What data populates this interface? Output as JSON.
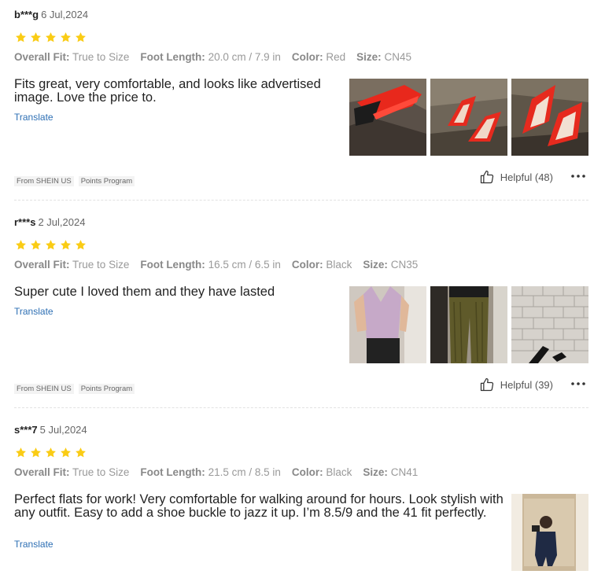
{
  "colors": {
    "star": "#facc15",
    "link": "#2d6fb4",
    "label": "#888888",
    "value": "#999999"
  },
  "icons": {
    "star": "star-icon",
    "helpful": "thumbs-up-icon",
    "more": "more-dots-icon"
  },
  "reviews": [
    {
      "user": "b***g",
      "date": "6 Jul,2024",
      "rating": 5,
      "attrs": [
        {
          "label": "Overall Fit:",
          "value": "True to Size"
        },
        {
          "label": "Foot Length:",
          "value": "20.0 cm / 7.9 in"
        },
        {
          "label": "Color:",
          "value": "Red"
        },
        {
          "label": "Size:",
          "value": "CN45"
        }
      ],
      "text": "Fits great, very comfortable, and looks like advertised image. Love the price to.",
      "translate": "Translate",
      "tags": [
        "From SHEIN US",
        "Points Program"
      ],
      "helpful": "Helpful (48)"
    },
    {
      "user": "r***s",
      "date": "2 Jul,2024",
      "rating": 5,
      "attrs": [
        {
          "label": "Overall Fit:",
          "value": "True to Size"
        },
        {
          "label": "Foot Length:",
          "value": "16.5 cm / 6.5 in"
        },
        {
          "label": "Color:",
          "value": "Black"
        },
        {
          "label": "Size:",
          "value": "CN35"
        }
      ],
      "text": "Super cute I loved them and they have lasted",
      "translate": "Translate",
      "tags": [
        "From SHEIN US",
        "Points Program"
      ],
      "helpful": "Helpful (39)"
    },
    {
      "user": "s***7",
      "date": "5 Jul,2024",
      "rating": 5,
      "attrs": [
        {
          "label": "Overall Fit:",
          "value": "True to Size"
        },
        {
          "label": "Foot Length:",
          "value": "21.5 cm / 8.5 in"
        },
        {
          "label": "Color:",
          "value": "Black"
        },
        {
          "label": "Size:",
          "value": "CN41"
        }
      ],
      "text": "Perfect flats for work! Very comfortable for walking around for hours. Look stylish with any outfit. Easy to add a shoe buckle to jazz it up. I’m 8.5/9 and the 41 fit perfectly.",
      "translate": "Translate"
    }
  ]
}
